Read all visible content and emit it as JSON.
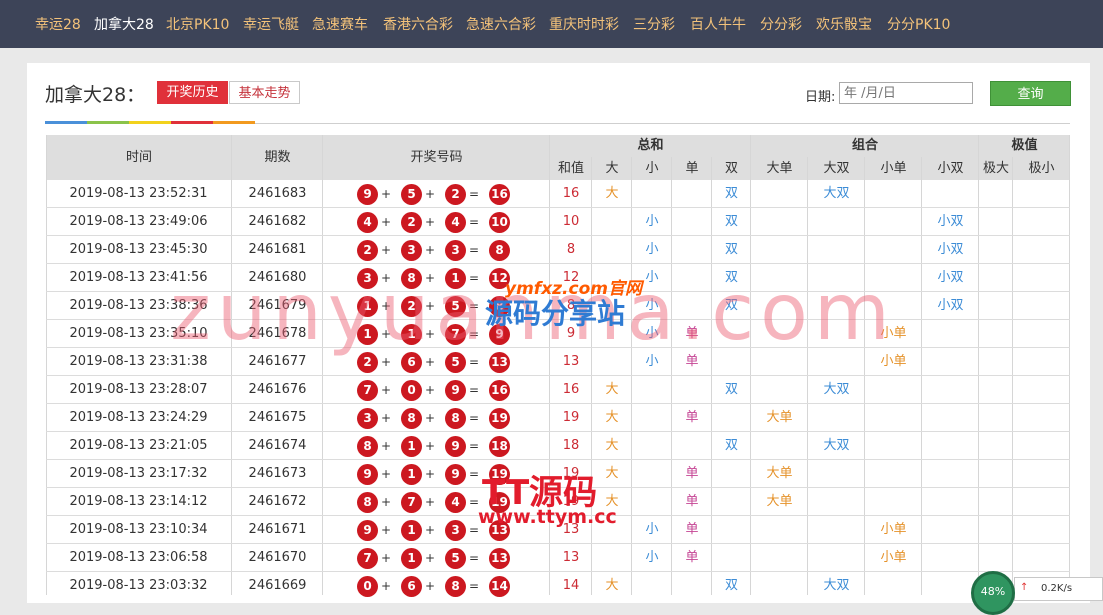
{
  "nav": {
    "items": [
      "幸运28",
      "加拿大28",
      "北京PK10",
      "幸运飞艇",
      "急速赛车",
      "香港六合彩",
      "急速六合彩",
      "重庆时时彩",
      "三分彩",
      "百人牛牛",
      "分分彩",
      "欢乐骰宝",
      "分分PK10"
    ],
    "active_index": 1
  },
  "page": {
    "title": "加拿大28：",
    "tab_history": "开奖历史",
    "tab_trend": "基本走势",
    "date_label": "日期:",
    "date_placeholder": "年 /月/日",
    "query_button": "查询",
    "tab_colors": [
      "#4a90d9",
      "#8bc34a",
      "#f2d21c",
      "#e0313a",
      "#f29a1f"
    ],
    "accent": "#e0313a"
  },
  "table": {
    "headers": {
      "time": "时间",
      "issue": "期数",
      "numbers": "开奖号码",
      "sum_group": "总和",
      "combo_group": "组合",
      "extreme_group": "极值",
      "sum_value": "和值",
      "big": "大",
      "small": "小",
      "odd": "单",
      "even": "双",
      "big_odd": "大单",
      "big_even": "大双",
      "small_odd": "小单",
      "small_even": "小双",
      "extreme_big": "极大",
      "extreme_small": "极小"
    },
    "rows": [
      {
        "time": "2019-08-13 23:52:31",
        "issue": "2461683",
        "n1": "9",
        "n2": "5",
        "n3": "2",
        "sum": "16",
        "big": "大",
        "small": "",
        "odd": "",
        "even": "双",
        "big_odd": "",
        "big_even": "大双",
        "small_odd": "",
        "small_even": "",
        "ext_big": "",
        "ext_small": ""
      },
      {
        "time": "2019-08-13 23:49:06",
        "issue": "2461682",
        "n1": "4",
        "n2": "2",
        "n3": "4",
        "sum": "10",
        "big": "",
        "small": "小",
        "odd": "",
        "even": "双",
        "big_odd": "",
        "big_even": "",
        "small_odd": "",
        "small_even": "小双",
        "ext_big": "",
        "ext_small": ""
      },
      {
        "time": "2019-08-13 23:45:30",
        "issue": "2461681",
        "n1": "2",
        "n2": "3",
        "n3": "3",
        "sum": "8",
        "big": "",
        "small": "小",
        "odd": "",
        "even": "双",
        "big_odd": "",
        "big_even": "",
        "small_odd": "",
        "small_even": "小双",
        "ext_big": "",
        "ext_small": ""
      },
      {
        "time": "2019-08-13 23:41:56",
        "issue": "2461680",
        "n1": "3",
        "n2": "8",
        "n3": "1",
        "sum": "12",
        "big": "",
        "small": "小",
        "odd": "",
        "even": "双",
        "big_odd": "",
        "big_even": "",
        "small_odd": "",
        "small_even": "小双",
        "ext_big": "",
        "ext_small": ""
      },
      {
        "time": "2019-08-13 23:38:36",
        "issue": "2461679",
        "n1": "1",
        "n2": "2",
        "n3": "5",
        "sum": "8",
        "big": "",
        "small": "小",
        "odd": "",
        "even": "双",
        "big_odd": "",
        "big_even": "",
        "small_odd": "",
        "small_even": "小双",
        "ext_big": "",
        "ext_small": ""
      },
      {
        "time": "2019-08-13 23:35:10",
        "issue": "2461678",
        "n1": "1",
        "n2": "1",
        "n3": "7",
        "sum": "9",
        "big": "",
        "small": "小",
        "odd": "单",
        "even": "",
        "big_odd": "",
        "big_even": "",
        "small_odd": "小单",
        "small_even": "",
        "ext_big": "",
        "ext_small": ""
      },
      {
        "time": "2019-08-13 23:31:38",
        "issue": "2461677",
        "n1": "2",
        "n2": "6",
        "n3": "5",
        "sum": "13",
        "big": "",
        "small": "小",
        "odd": "单",
        "even": "",
        "big_odd": "",
        "big_even": "",
        "small_odd": "小单",
        "small_even": "",
        "ext_big": "",
        "ext_small": ""
      },
      {
        "time": "2019-08-13 23:28:07",
        "issue": "2461676",
        "n1": "7",
        "n2": "0",
        "n3": "9",
        "sum": "16",
        "big": "大",
        "small": "",
        "odd": "",
        "even": "双",
        "big_odd": "",
        "big_even": "大双",
        "small_odd": "",
        "small_even": "",
        "ext_big": "",
        "ext_small": ""
      },
      {
        "time": "2019-08-13 23:24:29",
        "issue": "2461675",
        "n1": "3",
        "n2": "8",
        "n3": "8",
        "sum": "19",
        "big": "大",
        "small": "",
        "odd": "单",
        "even": "",
        "big_odd": "大单",
        "big_even": "",
        "small_odd": "",
        "small_even": "",
        "ext_big": "",
        "ext_small": ""
      },
      {
        "time": "2019-08-13 23:21:05",
        "issue": "2461674",
        "n1": "8",
        "n2": "1",
        "n3": "9",
        "sum": "18",
        "big": "大",
        "small": "",
        "odd": "",
        "even": "双",
        "big_odd": "",
        "big_even": "大双",
        "small_odd": "",
        "small_even": "",
        "ext_big": "",
        "ext_small": ""
      },
      {
        "time": "2019-08-13 23:17:32",
        "issue": "2461673",
        "n1": "9",
        "n2": "1",
        "n3": "9",
        "sum": "19",
        "big": "大",
        "small": "",
        "odd": "单",
        "even": "",
        "big_odd": "大单",
        "big_even": "",
        "small_odd": "",
        "small_even": "",
        "ext_big": "",
        "ext_small": ""
      },
      {
        "time": "2019-08-13 23:14:12",
        "issue": "2461672",
        "n1": "8",
        "n2": "7",
        "n3": "4",
        "sum": "19",
        "big": "大",
        "small": "",
        "odd": "单",
        "even": "",
        "big_odd": "大单",
        "big_even": "",
        "small_odd": "",
        "small_even": "",
        "ext_big": "",
        "ext_small": ""
      },
      {
        "time": "2019-08-13 23:10:34",
        "issue": "2461671",
        "n1": "9",
        "n2": "1",
        "n3": "3",
        "sum": "13",
        "big": "",
        "small": "小",
        "odd": "单",
        "even": "",
        "big_odd": "",
        "big_even": "",
        "small_odd": "小单",
        "small_even": "",
        "ext_big": "",
        "ext_small": ""
      },
      {
        "time": "2019-08-13 23:06:58",
        "issue": "2461670",
        "n1": "7",
        "n2": "1",
        "n3": "5",
        "sum": "13",
        "big": "",
        "small": "小",
        "odd": "单",
        "even": "",
        "big_odd": "",
        "big_even": "",
        "small_odd": "小单",
        "small_even": "",
        "ext_big": "",
        "ext_small": ""
      },
      {
        "time": "2019-08-13 23:03:32",
        "issue": "2461669",
        "n1": "0",
        "n2": "6",
        "n3": "8",
        "sum": "14",
        "big": "大",
        "small": "",
        "odd": "",
        "even": "双",
        "big_odd": "",
        "big_even": "大双",
        "small_odd": "",
        "small_even": "",
        "ext_big": "",
        "ext_small": ""
      }
    ]
  },
  "watermarks": {
    "main": "zunyuanma.com",
    "logo_top": "ymfxz.com官网",
    "logo_main": "源码分享站",
    "logo2_main": "TT源码",
    "logo2_url": "www.ttym.cc"
  },
  "speed_widget": {
    "percent": "48%",
    "rate": "0.2K/s"
  }
}
